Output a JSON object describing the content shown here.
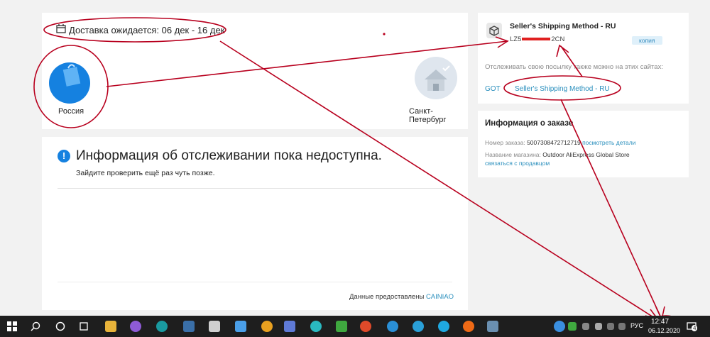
{
  "delivery": {
    "text": "Доставка ожидается: 06 дек - 16 дек",
    "origin": "Россия",
    "destination": "Санкт-Петербург"
  },
  "tracking_info": {
    "title": "Информация об отслеживании пока недоступна.",
    "subtitle": "Зайдите проверить ещё раз чуть позже.",
    "provided_by_label": "Данные предоставлены",
    "provider": "CAINIAO"
  },
  "shipping": {
    "method": "Seller's Shipping Method - RU",
    "tracking_prefix": "LZ5",
    "tracking_suffix": "2CN",
    "copy_label": "копия",
    "also_track_label": "Отслеживать свою посылку также можно на этих сайтах:",
    "got_link": "GOT",
    "method_link": "Seller's Shipping Method - RU"
  },
  "order": {
    "title": "Информация о заказе",
    "number_label": "Номер заказа:",
    "number_value": "5007308472712719",
    "details_link": "посмотреть детали",
    "store_label": "Название магазина:",
    "store_value": "Outdoor AliExpress Global Store",
    "contact_link": "связаться с продавцом"
  },
  "taskbar": {
    "lang": "РУС",
    "time": "12:47",
    "date": "06.12.2020",
    "notifications_count": "4"
  },
  "colors": {
    "accent": "#1581e0",
    "link": "#2a8fbd",
    "annotation": "#b8001e"
  }
}
